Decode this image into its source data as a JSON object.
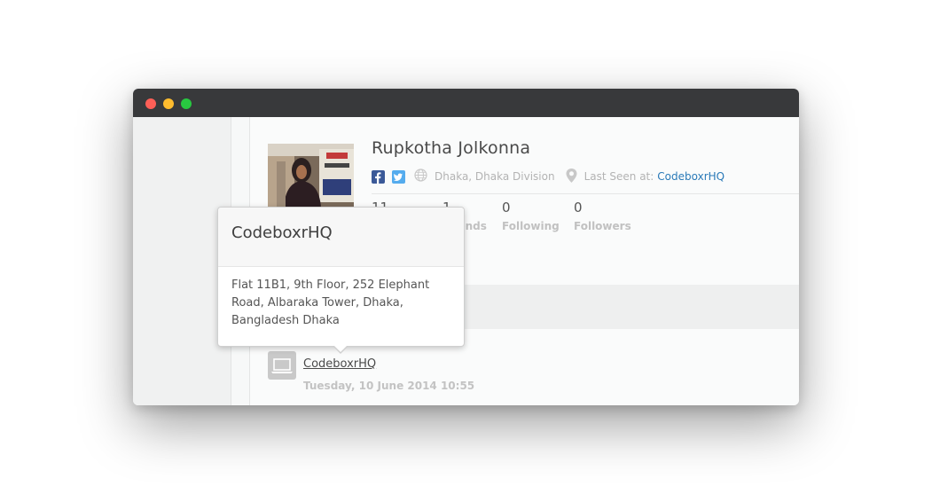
{
  "profile": {
    "name": "Rupkotha Jolkonna",
    "location": "Dhaka, Dhaka Division",
    "last_seen_label": "Last Seen at:",
    "last_seen_place": "CodeboxrHQ"
  },
  "stats": [
    {
      "value": "11",
      "label": ""
    },
    {
      "value": "1",
      "label": "Friends"
    },
    {
      "value": "0",
      "label": "Following"
    },
    {
      "value": "0",
      "label": "Followers"
    }
  ],
  "device": {
    "name": "CodeboxrHQ",
    "time": "Tuesday, 10 June 2014 10:55"
  },
  "popover": {
    "title": "CodeboxrHQ",
    "address": "Flat 11B1, 9th Floor, 252 Elephant Road, Albaraka Tower, Dhaka, Bangladesh Dhaka"
  },
  "colors": {
    "titlebar": "#38393b",
    "close": "#fd5f57",
    "minimize": "#febc2e",
    "zoom": "#28c840",
    "facebook": "#3b5998",
    "twitter": "#55acee",
    "link": "#2a7ab8"
  },
  "icons": [
    "facebook-icon",
    "twitter-icon",
    "globe-icon",
    "map-pin-icon",
    "laptop-icon"
  ]
}
